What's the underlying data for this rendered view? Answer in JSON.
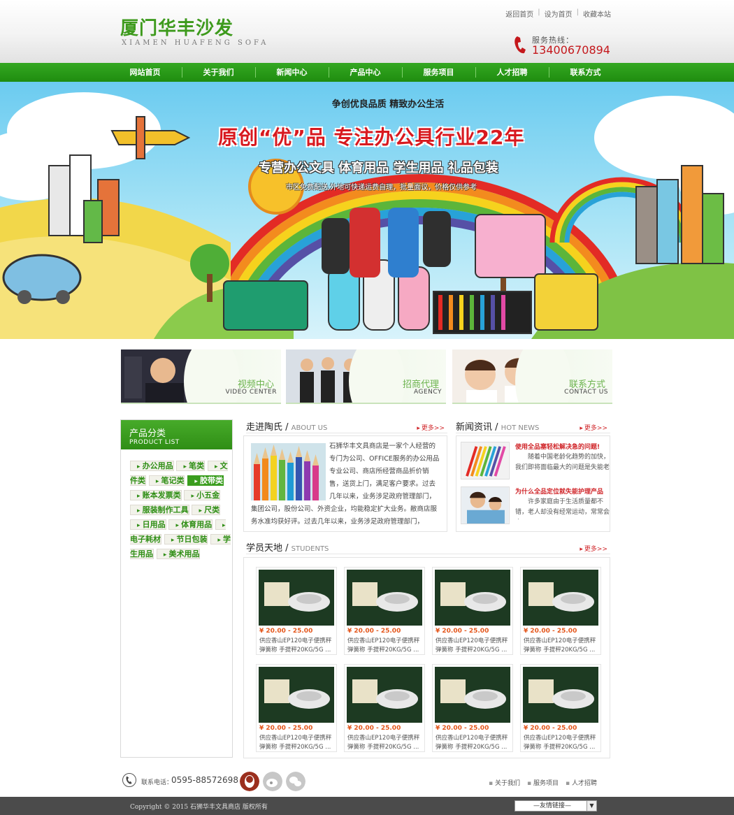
{
  "header": {
    "logo_cn": "厦门华丰沙发",
    "logo_en": "XIAMEN HUAFENG SOFA",
    "top_links": [
      "返回首页",
      "设为首页",
      "收藏本站"
    ],
    "hotline_label": "服务热线：",
    "hotline_number": "13400670894"
  },
  "nav": [
    "网站首页",
    "关于我们",
    "新闻中心",
    "产品中心",
    "服务项目",
    "人才招聘",
    "联系方式"
  ],
  "banner": {
    "tagline": "争创优良品质 精致办公生活",
    "title": "原创“优”品  专注办公具行业22年",
    "subtitle": "专营办公文具 体育用品 学生用品 礼品包装",
    "note": "市区免费配送,外地可快递运费自理，批量面议，价格仅供参考"
  },
  "promos": [
    {
      "cn": "视频中心",
      "en": "VIDEO CENTER"
    },
    {
      "cn": "招商代理",
      "en": "AGENCY"
    },
    {
      "cn": "联系方式",
      "en": "CONTACT US"
    }
  ],
  "sidebar": {
    "title_cn": "产品分类",
    "title_en": "PRODUCT LIST",
    "items": [
      "办公用品",
      "笔类",
      "文件类",
      "笔记类",
      "胶带类",
      "账本发票类",
      "小五金",
      "服装制作工具",
      "尺类",
      "日用品",
      "体育用品",
      "电子耗材",
      "节日包装",
      "学生用品",
      "美术用品"
    ],
    "active_index": 4
  },
  "about": {
    "title_cn": "走进陶氏",
    "title_en": "ABOUT US",
    "more": "更多>>",
    "text": "石狮华丰文具商店是一家个人经营的专门为公司、OFFICE服务的办公用品专业公司、商店所经营商品折价销售，送货上门，满足客户要求。过去几年以来，业务涉足政府管理部门，集团公司，股份公司、外资企业，均能稳定扩大业务。敝商店服务水准均获好评。过去几年以来，业务涉足政府管理部门，"
  },
  "news": {
    "title_cn": "新闻资讯",
    "title_en": "HOT NEWS",
    "more": "更多>>",
    "items": [
      {
        "title": "使用全品塞轻松解决急的问题!",
        "desc": "随着中国老龄化趋势的加快，我们即将面临最大的问题是失能老"
      },
      {
        "title": "为什么全品定位就失能护理产品",
        "desc": "许多家庭由于生活质量都不错，老人却没有经常运动，常常会出"
      }
    ]
  },
  "students": {
    "title_cn": "学员天地",
    "title_en": "STUDENTS",
    "more": "更多>>",
    "products": [
      {
        "price": "¥ 20.00 - 25.00",
        "name": "供应香山EP120电子便携秤弹簧称 手提秤20KG/5G ..."
      },
      {
        "price": "¥ 20.00 - 25.00",
        "name": "供应香山EP120电子便携秤弹簧称 手提秤20KG/5G ..."
      },
      {
        "price": "¥ 20.00 - 25.00",
        "name": "供应香山EP120电子便携秤弹簧称 手提秤20KG/5G ..."
      },
      {
        "price": "¥ 20.00 - 25.00",
        "name": "供应香山EP120电子便携秤弹簧称 手提秤20KG/5G ..."
      },
      {
        "price": "¥ 20.00 - 25.00",
        "name": "供应香山EP120电子便携秤弹簧称 手提秤20KG/5G ..."
      },
      {
        "price": "¥ 20.00 - 25.00",
        "name": "供应香山EP120电子便携秤弹簧称 手提秤20KG/5G ..."
      },
      {
        "price": "¥ 20.00 - 25.00",
        "name": "供应香山EP120电子便携秤弹簧称 手提秤20KG/5G ..."
      },
      {
        "price": "¥ 20.00 - 25.00",
        "name": "供应香山EP120电子便携秤弹簧称 手提秤20KG/5G ..."
      }
    ]
  },
  "contact": {
    "label": "联系电话：",
    "phone": "0595-88572698",
    "social_icons": [
      "qq-icon",
      "weibo-icon",
      "wechat-icon"
    ],
    "links": [
      "关于我们",
      "服务项目",
      "人才招聘"
    ]
  },
  "footer": {
    "copyright": "Copyright © 2015 石狮华丰文具商店  版权所有",
    "friend_link": "—友情链接—"
  },
  "colors": {
    "brand_green": "#2f8e15",
    "accent_red": "#d0262a",
    "price_orange": "#e4561b"
  }
}
